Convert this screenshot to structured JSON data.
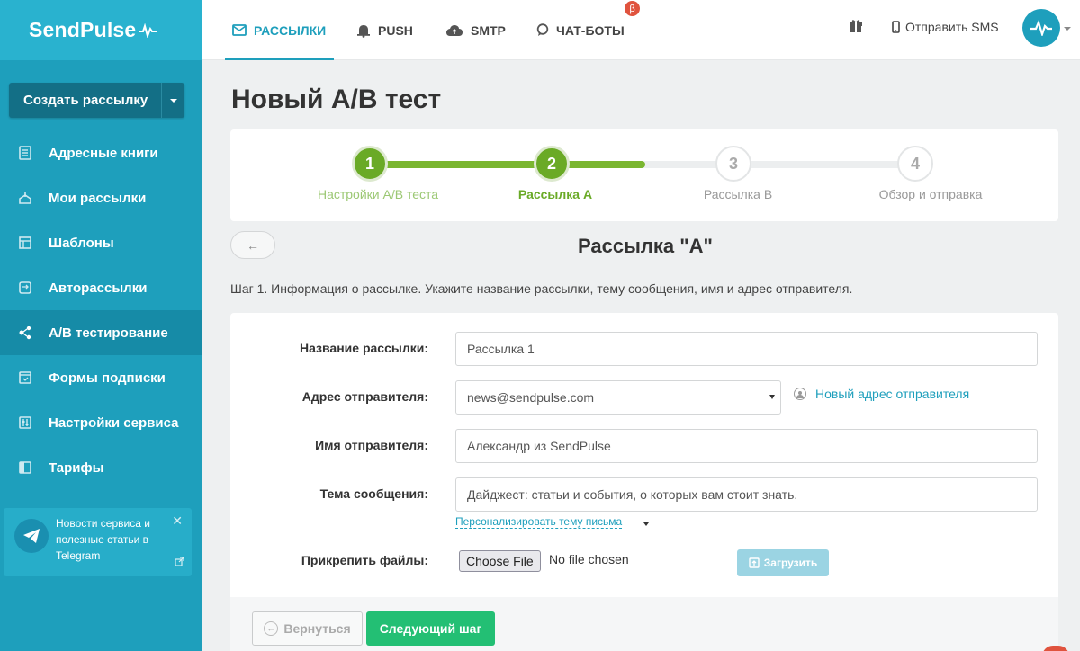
{
  "brand": {
    "logo_text": "SendPulse"
  },
  "sidebar": {
    "create_label": "Создать рассылку",
    "items": [
      {
        "label": "Адресные книги",
        "icon": "address-book-icon"
      },
      {
        "label": "Мои рассылки",
        "icon": "campaigns-icon"
      },
      {
        "label": "Шаблоны",
        "icon": "templates-icon"
      },
      {
        "label": "Авторассылки",
        "icon": "automation-icon"
      },
      {
        "label": "A/B тестирование",
        "icon": "ab-test-icon",
        "active": true
      },
      {
        "label": "Формы подписки",
        "icon": "forms-icon"
      },
      {
        "label": "Настройки сервиса",
        "icon": "settings-icon"
      },
      {
        "label": "Тарифы",
        "icon": "pricing-icon"
      }
    ],
    "telegram_promo": "Новости сервиса и полезные статьи в Telegram"
  },
  "topbar": {
    "tabs": [
      {
        "label": "РАССЫЛКИ",
        "icon": "envelope-icon",
        "active": true
      },
      {
        "label": "PUSH",
        "icon": "bell-icon"
      },
      {
        "label": "SMTP",
        "icon": "cloud-upload-icon"
      },
      {
        "label": "ЧАТ-БОТЫ",
        "icon": "chat-icon"
      }
    ],
    "beta_badge": "β",
    "sms_label": "Отправить SMS"
  },
  "page": {
    "title": "Новый A/B тест",
    "subtitle": "Рассылка \"A\"",
    "back_arrow": "←",
    "description": "Шаг 1. Информация о рассылке. Укажите название рассылки, тему сообщения, имя и адрес отправителя."
  },
  "stepper": {
    "steps": [
      {
        "number": "1",
        "label": "Настройки A/B теста",
        "state": "done"
      },
      {
        "number": "2",
        "label": "Рассылка A",
        "state": "current"
      },
      {
        "number": "3",
        "label": "Рассылка B",
        "state": "pending"
      },
      {
        "number": "4",
        "label": "Обзор и отправка",
        "state": "pending"
      }
    ]
  },
  "form": {
    "name_label": "Название рассылки:",
    "name_value": "Рассылка 1",
    "sender_label": "Адрес отправителя:",
    "sender_value": "news@sendpulse.com",
    "new_sender_link": "Новый адрес отправителя",
    "sender_name_label": "Имя отправителя:",
    "sender_name_value": "Александр из SendPulse",
    "subject_label": "Тема сообщения:",
    "subject_value": "Дайджест: статьи и события, о которых вам стоит знать.",
    "personalize_link": "Персонализировать тему письма",
    "attach_label": "Прикрепить файлы:",
    "choose_file": "Choose File",
    "no_file": "No file chosen",
    "upload_label": "Загрузить"
  },
  "footer": {
    "back_label": "Вернуться",
    "next_label": "Следующий шаг"
  },
  "colors": {
    "sidebar": "#1e9fbc",
    "accent": "#1e9fbc",
    "step_green": "#6aaa26",
    "primary_button": "#23bf74"
  }
}
